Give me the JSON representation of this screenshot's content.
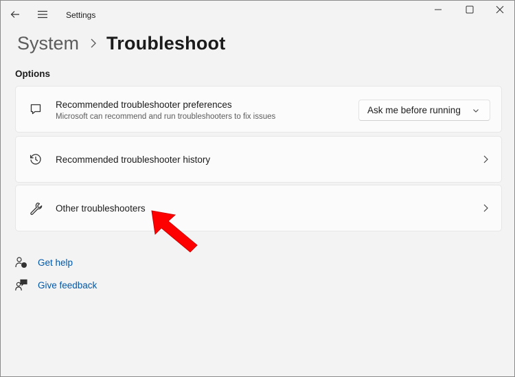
{
  "window": {
    "title": "Settings"
  },
  "breadcrumb": {
    "parent": "System",
    "current": "Troubleshoot"
  },
  "section": {
    "label": "Options"
  },
  "cards": [
    {
      "title": "Recommended troubleshooter preferences",
      "description": "Microsoft can recommend and run troubleshooters to fix issues",
      "dropdown_value": "Ask me before running",
      "icon": "chat-bubble-icon"
    },
    {
      "title": "Recommended troubleshooter history",
      "icon": "history-icon"
    },
    {
      "title": "Other troubleshooters",
      "icon": "wrench-icon"
    }
  ],
  "links": {
    "get_help": "Get help",
    "give_feedback": "Give feedback"
  },
  "colors": {
    "link": "#0057a8",
    "annotation": "#ff0000",
    "background": "#f3f3f3"
  }
}
